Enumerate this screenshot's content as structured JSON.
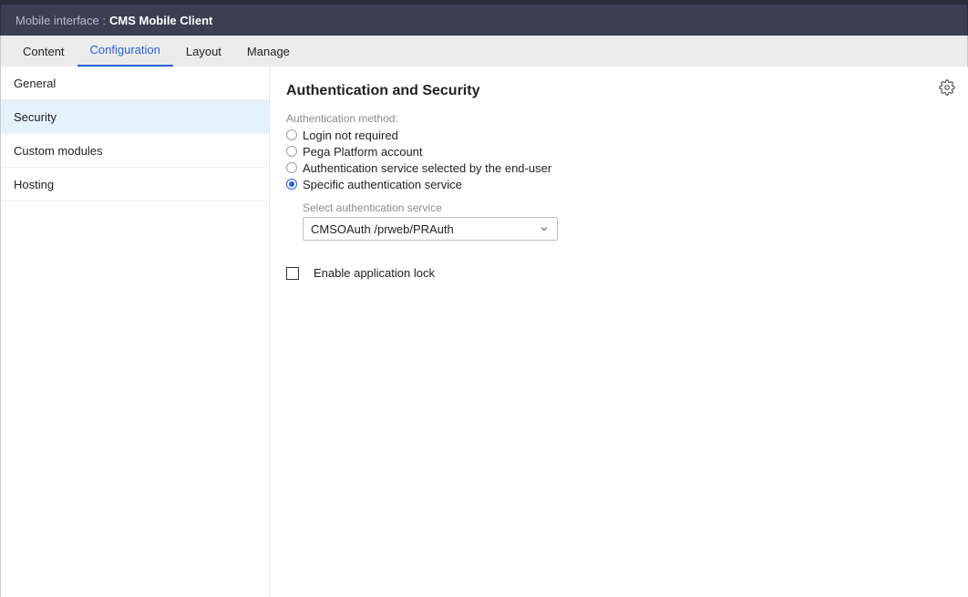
{
  "header": {
    "prefix": "Mobile interface :",
    "title": "CMS Mobile Client"
  },
  "tabs": [
    {
      "label": "Content",
      "active": false
    },
    {
      "label": "Configuration",
      "active": true
    },
    {
      "label": "Layout",
      "active": false
    },
    {
      "label": "Manage",
      "active": false
    }
  ],
  "sidebar": {
    "items": [
      {
        "label": "General",
        "active": false
      },
      {
        "label": "Security",
        "active": true
      },
      {
        "label": "Custom modules",
        "active": false
      },
      {
        "label": "Hosting",
        "active": false
      }
    ]
  },
  "main": {
    "title": "Authentication and Security",
    "auth_method_label": "Authentication method:",
    "radios": [
      {
        "label": "Login not required",
        "selected": false
      },
      {
        "label": "Pega Platform account",
        "selected": false
      },
      {
        "label": "Authentication service selected by the end-user",
        "selected": false
      },
      {
        "label": "Specific authentication service",
        "selected": true
      }
    ],
    "select": {
      "label": "Select authentication service",
      "value": "CMSOAuth /prweb/PRAuth"
    },
    "checkbox": {
      "label": "Enable application lock",
      "checked": false
    }
  }
}
